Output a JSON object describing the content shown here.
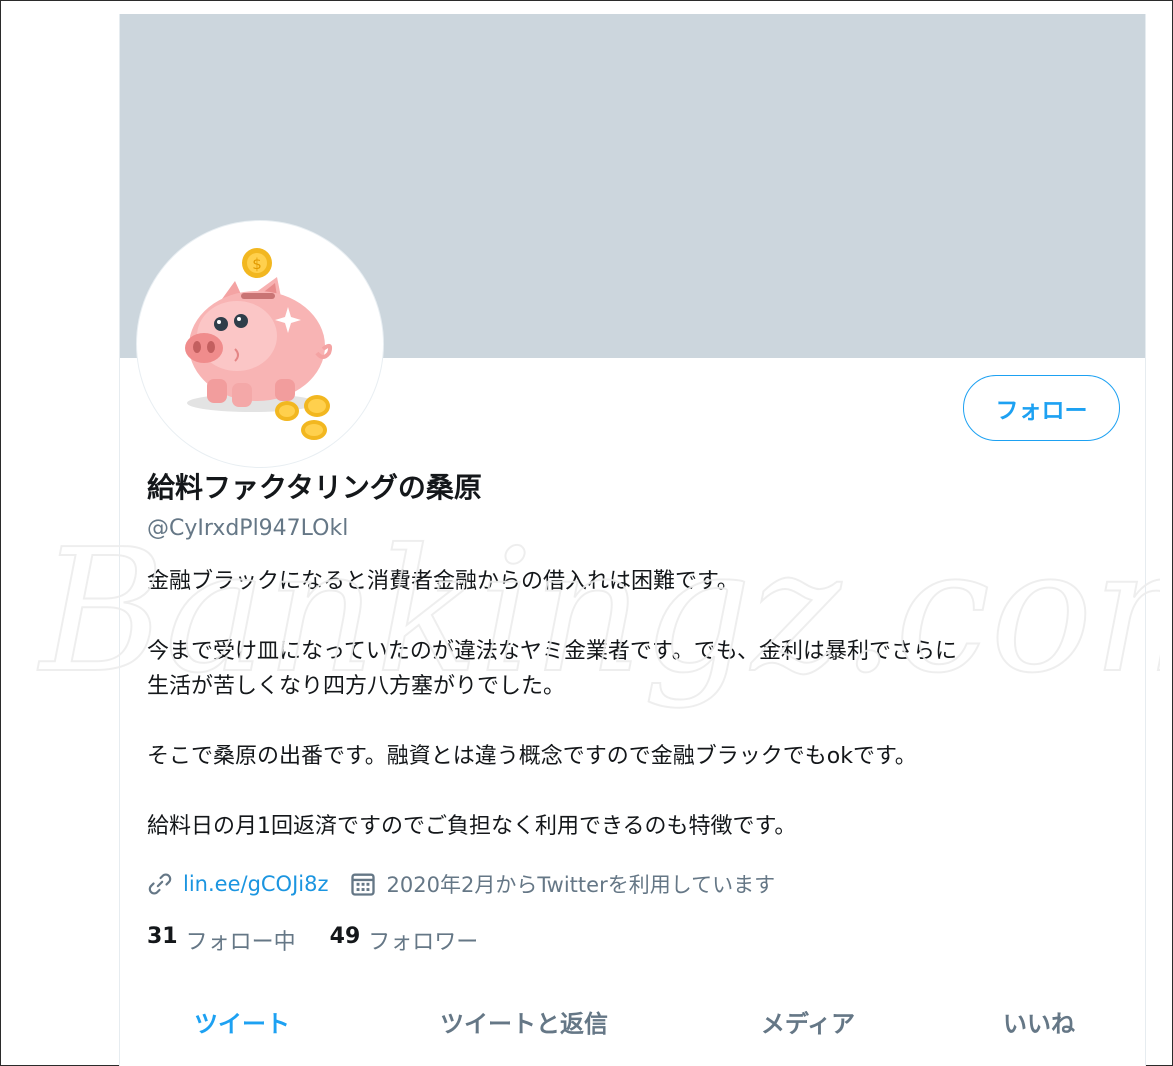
{
  "profile": {
    "display_name": "給料ファクタリングの桑原",
    "handle": "@CyIrxdPl947LOkl",
    "follow_label": "フォロー",
    "bio": [
      "金融ブラックになると消費者金融からの借入れは困難です。",
      "今まで受け皿になっていたのが違法なヤミ金業者です。でも、金利は暴利でさらに",
      "生活が苦しくなり四方八方塞がりでした。",
      "そこで桑原の出番です。融資とは違う概念ですので金融ブラックでもokです。",
      "給料日の月1回返済ですのでご負担なく利用できるのも特徴です。"
    ],
    "link": "lin.ee/gCOJi8z",
    "joined": "2020年2月からTwitterを利用しています",
    "following_count": "31",
    "following_label": "フォロー中",
    "followers_count": "49",
    "followers_label": "フォロワー"
  },
  "tabs": [
    {
      "label": "ツイート",
      "active": true
    },
    {
      "label": "ツイートと返信",
      "active": false
    },
    {
      "label": "メディア",
      "active": false
    },
    {
      "label": "いいね",
      "active": false
    }
  ],
  "watermark": "Bankingz.com",
  "icons": {
    "link": "link-icon",
    "calendar": "calendar-icon",
    "avatar": "piggy-bank-avatar"
  },
  "colors": {
    "accent": "#1da1f2",
    "banner": "#ccd6dd",
    "secondary_text": "#657786"
  }
}
